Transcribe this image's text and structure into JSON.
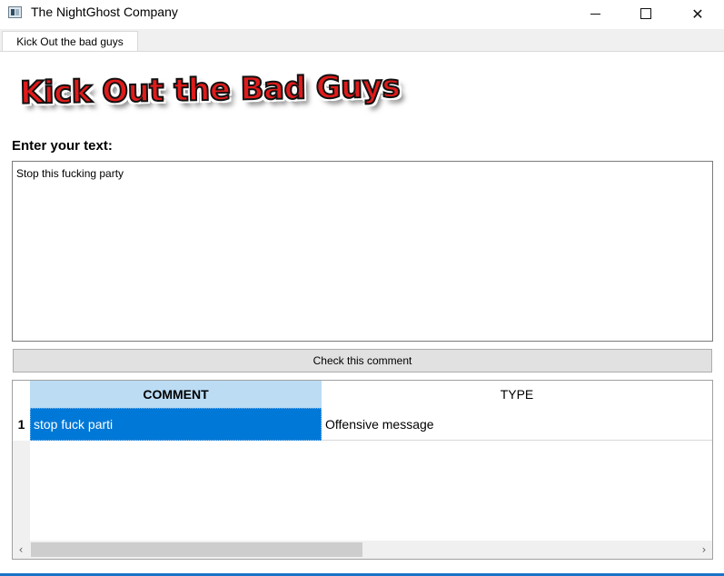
{
  "window": {
    "title": "The NightGhost Company",
    "icon": "app-window-icon",
    "controls": {
      "minimize": "minimize-icon",
      "maximize": "maximize-icon",
      "close": "close-icon",
      "close_glyph": "✕"
    }
  },
  "tabs": [
    {
      "label": "Kick Out the bad guys",
      "active": true
    }
  ],
  "logo": {
    "text": "Kick Out the Bad Guys",
    "colors": {
      "fill": "#e01b1b",
      "outline": "#111111"
    }
  },
  "form": {
    "prompt_label": "Enter your text:",
    "text_value": "Stop this fucking party",
    "check_button_label": "Check this comment"
  },
  "table": {
    "columns": [
      "COMMENT",
      "TYPE"
    ],
    "rows": [
      {
        "num": "1",
        "comment": "stop fuck parti",
        "type": "Offensive message"
      }
    ],
    "selected_color": "#0078d7",
    "header_highlight": "#bcdcf4"
  },
  "scrollbar": {
    "left_arrow": "‹",
    "right_arrow": "›"
  }
}
